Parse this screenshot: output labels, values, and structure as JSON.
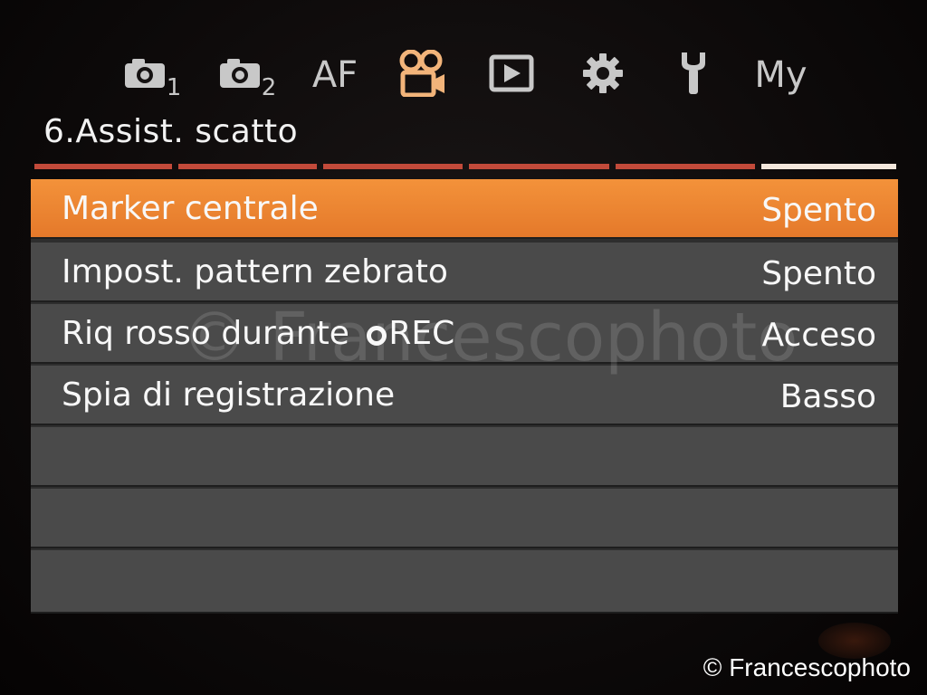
{
  "tabs": [
    {
      "icon": "camera-icon",
      "sub": "1"
    },
    {
      "icon": "camera-icon",
      "sub": "2"
    },
    {
      "label": "AF"
    },
    {
      "icon": "movie-camera-icon"
    },
    {
      "icon": "playback-icon"
    },
    {
      "icon": "gear-icon"
    },
    {
      "icon": "wrench-icon"
    },
    {
      "label": "My"
    }
  ],
  "active_tab": 3,
  "page_title": "6.Assist. scatto",
  "subtabs": {
    "count": 6,
    "active": 6
  },
  "menu": {
    "items": [
      {
        "label": "Marker centrale",
        "value": "Spento",
        "selected": true
      },
      {
        "label": "Impost. pattern zebrato",
        "value": "Spento"
      },
      {
        "label_before": "Riq rosso durante ",
        "label_after": "REC",
        "rec_icon": "record-ring-icon",
        "value": "Acceso"
      },
      {
        "label": "Spia di registrazione",
        "value": "Basso"
      },
      {
        "label": "",
        "value": ""
      },
      {
        "label": "",
        "value": ""
      },
      {
        "label": "",
        "value": ""
      }
    ]
  },
  "watermark": "© Francescophoto",
  "copyright": "© Francescophoto",
  "colors": {
    "selected_row": "#f3923a",
    "row_bg": "#4a4a4a",
    "subtab": "#c24a3a",
    "subtab_active": "#f3e7dc",
    "active_tab_icon": "#f2b47a"
  }
}
